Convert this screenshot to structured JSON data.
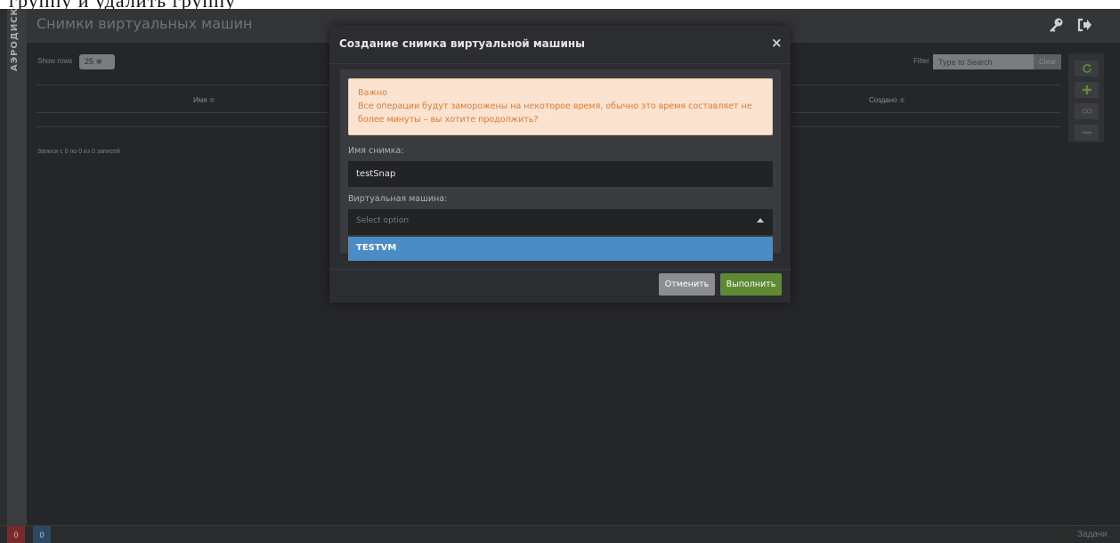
{
  "crop_text": "группу и удалить группу",
  "brand": {
    "logo_text": "АЭРОДИСК"
  },
  "header": {
    "title": "Снимки виртуальных машин",
    "icons": [
      "key-icon",
      "sign-out-icon"
    ]
  },
  "controls": {
    "show_rows_label": "Show rows",
    "rows_value": "25 ≑",
    "filter_label": "Filter",
    "filter_placeholder": "Type to Search",
    "clear_label": "Clear"
  },
  "table": {
    "columns": [
      "Имя ≑",
      "Создано ≑"
    ],
    "records_text": "Записи с 0 по 0 из 0 записей"
  },
  "side_buttons": [
    "refresh-icon",
    "plus-icon",
    "link-icon",
    "minus-icon"
  ],
  "statusbar": {
    "errors": "0",
    "info": "0",
    "tasks_label": "Задачи"
  },
  "modal": {
    "title": "Создание снимка виртуальной машины",
    "close": "×",
    "alert_title": "Важно",
    "alert_text": "Все операции будут заморожены на некоторое время, обычно это время составляет не более минуты – вы хотите продолжить?",
    "snap_label": "Имя снимка:",
    "snap_value": "testSnap",
    "vm_label": "Виртуальная машина:",
    "vm_placeholder": "Select option",
    "vm_option": "TESTVM",
    "cancel_label": "Отменить",
    "run_label": "Выполнить"
  },
  "colors": {
    "accent_green": "#5e8a33",
    "option_blue": "#4a8cc6",
    "alert_bg": "#fbe3cf",
    "alert_text": "#e07b38"
  }
}
